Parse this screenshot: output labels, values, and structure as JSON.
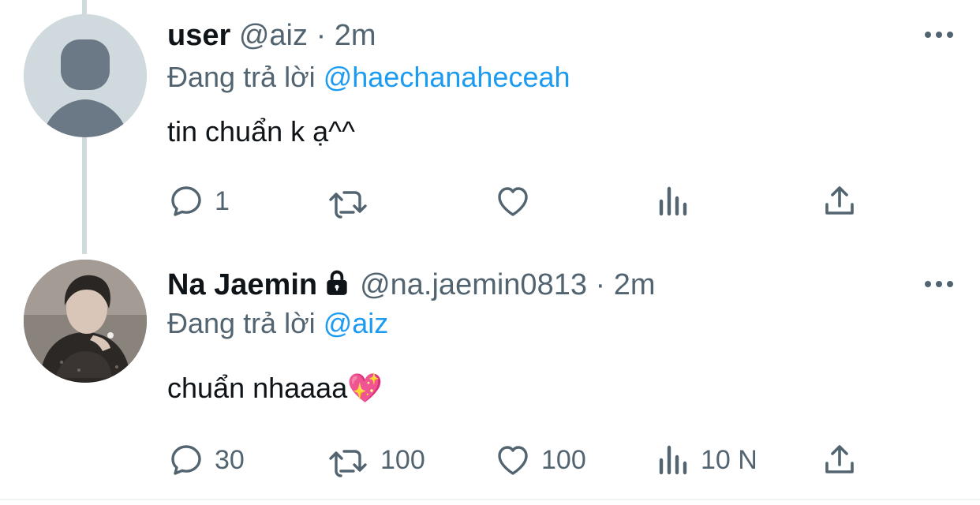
{
  "tweets": [
    {
      "name": "user",
      "handle": "@aiz",
      "separator": "·",
      "time": "2m",
      "reply_prefix": "Đang trả lời",
      "reply_to": "@haechanaheceah",
      "text": "tin chuẩn k ạ^^",
      "avatar": "default-avatar-silhouette",
      "locked": false,
      "actions": {
        "replies": "1",
        "retweets": "",
        "likes": "",
        "views": ""
      }
    },
    {
      "name": "Na Jaemin",
      "handle": "@na.jaemin0813",
      "separator": "·",
      "time": "2m",
      "reply_prefix": "Đang trả lời",
      "reply_to": "@aiz",
      "text": "chuẩn nhaaaa💖",
      "avatar": "profile-photo",
      "locked": true,
      "actions": {
        "replies": "30",
        "retweets": "100",
        "likes": "100",
        "views": "10 N"
      }
    }
  ],
  "colors": {
    "text": "#0f1419",
    "secondary": "#536471",
    "mention": "#1d9bf0",
    "thread_line": "#cfd9de",
    "avatar_bg": "#cfd9de",
    "avatar_silhouette": "#6b7886"
  },
  "icons": [
    "more-icon",
    "reply-icon",
    "retweet-icon",
    "like-icon",
    "views-icon",
    "share-icon",
    "lock-icon"
  ]
}
